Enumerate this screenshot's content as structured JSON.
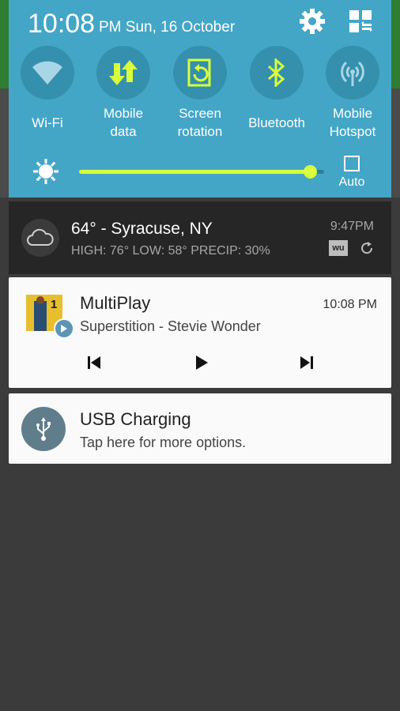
{
  "status": {
    "time": "10:08",
    "ampm_date": "PM Sun, 16 October"
  },
  "quick_settings": {
    "tiles": [
      {
        "label": "Wi-Fi",
        "icon": "wifi-icon"
      },
      {
        "label": "Mobile\ndata",
        "icon": "mobile-data-icon"
      },
      {
        "label": "Screen\nrotation",
        "icon": "screen-rotation-icon"
      },
      {
        "label": "Bluetooth",
        "icon": "bluetooth-icon"
      },
      {
        "label": "Mobile\nHotspot",
        "icon": "hotspot-icon"
      }
    ],
    "brightness_level": 0.97,
    "auto_label": "Auto"
  },
  "weather": {
    "title": "64° - Syracuse, NY",
    "details": "HIGH: 76° LOW: 58° PRECIP: 30%",
    "time": "9:47PM",
    "logo_text": "wu"
  },
  "music": {
    "app": "MultiPlay",
    "track": "Superstition - Stevie Wonder",
    "time": "10:08 PM",
    "album_number": "1"
  },
  "usb": {
    "title": "USB Charging",
    "subtitle": "Tap here for more options."
  },
  "colors": {
    "panel": "#44a6c6",
    "accent": "#d9ff3c",
    "tile_circle": "#3490ad",
    "background": "#3a3b3a"
  }
}
